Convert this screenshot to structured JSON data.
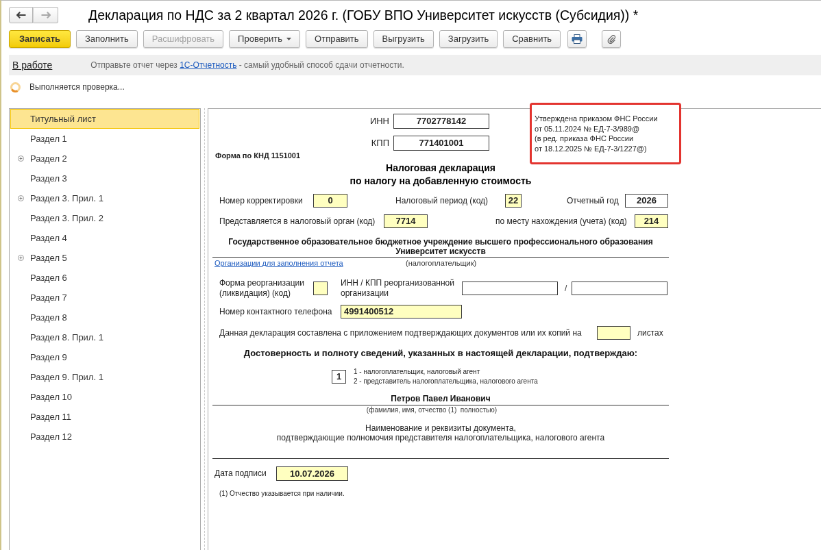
{
  "window": {
    "title": "Декларация по НДС за 2 квартал 2026 г. (ГОБУ ВПО Университет искусств (Субсидия)) *"
  },
  "navigation": [
    {
      "kind": "back",
      "disabled": false
    },
    {
      "kind": "forward",
      "disabled": true
    }
  ],
  "toolbar": [
    {
      "label": "Записать",
      "primary": true,
      "disabled": false,
      "dropdown": false
    },
    {
      "label": "Заполнить",
      "primary": false,
      "disabled": false,
      "dropdown": false
    },
    {
      "label": "Расшифровать",
      "primary": false,
      "disabled": true,
      "dropdown": false
    },
    {
      "label": "Проверить",
      "primary": false,
      "disabled": false,
      "dropdown": true
    },
    {
      "label": "Отправить",
      "primary": false,
      "disabled": false,
      "dropdown": false
    },
    {
      "label": "Выгрузить",
      "primary": false,
      "disabled": false,
      "dropdown": false
    },
    {
      "label": "Загрузить",
      "primary": false,
      "disabled": false,
      "dropdown": false
    },
    {
      "label": "Сравнить",
      "primary": false,
      "disabled": false,
      "dropdown": false
    }
  ],
  "status_bar": {
    "state": "В работе",
    "message_start": "Отправьте отчет через ",
    "link": "1С-Отчетность",
    "message_end": " - самый удобный способ сдачи отчетности."
  },
  "progress": {
    "text": "Выполняется проверка..."
  },
  "sidebar": {
    "items": [
      {
        "label": "Титульный лист",
        "selected": true,
        "expandable": false
      },
      {
        "label": "Раздел 1",
        "selected": false,
        "expandable": false
      },
      {
        "label": "Раздел 2",
        "selected": false,
        "expandable": true
      },
      {
        "label": "Раздел 3",
        "selected": false,
        "expandable": false
      },
      {
        "label": "Раздел 3. Прил. 1",
        "selected": false,
        "expandable": true
      },
      {
        "label": "Раздел 3. Прил. 2",
        "selected": false,
        "expandable": false
      },
      {
        "label": "Раздел 4",
        "selected": false,
        "expandable": false
      },
      {
        "label": "Раздел 5",
        "selected": false,
        "expandable": true
      },
      {
        "label": "Раздел 6",
        "selected": false,
        "expandable": false
      },
      {
        "label": "Раздел 7",
        "selected": false,
        "expandable": false
      },
      {
        "label": "Раздел 8",
        "selected": false,
        "expandable": false
      },
      {
        "label": "Раздел 8. Прил. 1",
        "selected": false,
        "expandable": false
      },
      {
        "label": "Раздел 9",
        "selected": false,
        "expandable": false
      },
      {
        "label": "Раздел 9. Прил. 1",
        "selected": false,
        "expandable": false
      },
      {
        "label": "Раздел 10",
        "selected": false,
        "expandable": false
      },
      {
        "label": "Раздел 11",
        "selected": false,
        "expandable": false
      },
      {
        "label": "Раздел 12",
        "selected": false,
        "expandable": false
      }
    ]
  },
  "form": {
    "inn": {
      "label": "ИНН",
      "value": "7702778142",
      "editable": false
    },
    "kpp": {
      "label": "КПП",
      "value": "771401001",
      "editable": false
    },
    "approval_note": "Утверждена приказом ФНС России\nот 05.11.2024 № ЕД-7-3/989@\n(в ред. приказа ФНС России\nот 18.12.2025 № ЕД-7-3/1227@)",
    "form_code": "Форма по КНД 1151001",
    "title": "Налоговая декларация\nпо налогу на добавленную стоимость",
    "correction_number": {
      "label": "Номер корректировки",
      "value": "0",
      "editable": true
    },
    "tax_period": {
      "label": "Налоговый период (код)",
      "value": "22",
      "editable": true
    },
    "reporting_year": {
      "label": "Отчетный год",
      "value": "2026",
      "editable": false
    },
    "tax_authority": {
      "label": "Представляется в налоговый орган (код)",
      "value": "7714",
      "editable": true
    },
    "location_code": {
      "label": "по месту нахождения (учета) (код)",
      "value": "214",
      "editable": true
    },
    "organization_type": "Государственное образовательное бюджетное учреждение высшего профессионального образования",
    "organization_name": "Университет искусств",
    "organizations_link": "Организации для заполнения отчета",
    "taxpayer_caption": "(налогоплательщик)",
    "reorganization_form": {
      "label": "Форма реорганизации\n(ликвидация) (код)",
      "editable": true
    },
    "reorganized_inn_kpp": {
      "label": "ИНН / КПП реорганизованной\nорганизации",
      "separator": "/",
      "editable": false
    },
    "phone": {
      "label": "Номер контактного телефона",
      "value": "4991400512",
      "editable": true
    },
    "attachment_sheets": {
      "label": "Данная декларация составлена с приложением подтверждающих документов или их копий на",
      "suffix": "листах",
      "editable": true
    },
    "confirmation_heading": "Достоверность и полноту сведений, указанных в настоящей декларации, подтверждаю:",
    "signer_type": {
      "value": "1",
      "editable": false,
      "options": [
        "1 - налогоплательщик, налоговый агент",
        "2 - представитель налогоплательщика, налогового агента"
      ]
    },
    "signer_name": "Петров Павел Иванович",
    "signer_caption": "(фамилия, имя, отчество (1)  полностью)",
    "authority_document": "Наименование и реквизиты документа,\nподтверждающие полномочия представителя налогоплательщика, налогового агента",
    "signature_date": {
      "label": "Дата подписи",
      "value": "10.07.2026",
      "editable": true
    },
    "footnote": "(1) Отчество указывается при наличии."
  }
}
